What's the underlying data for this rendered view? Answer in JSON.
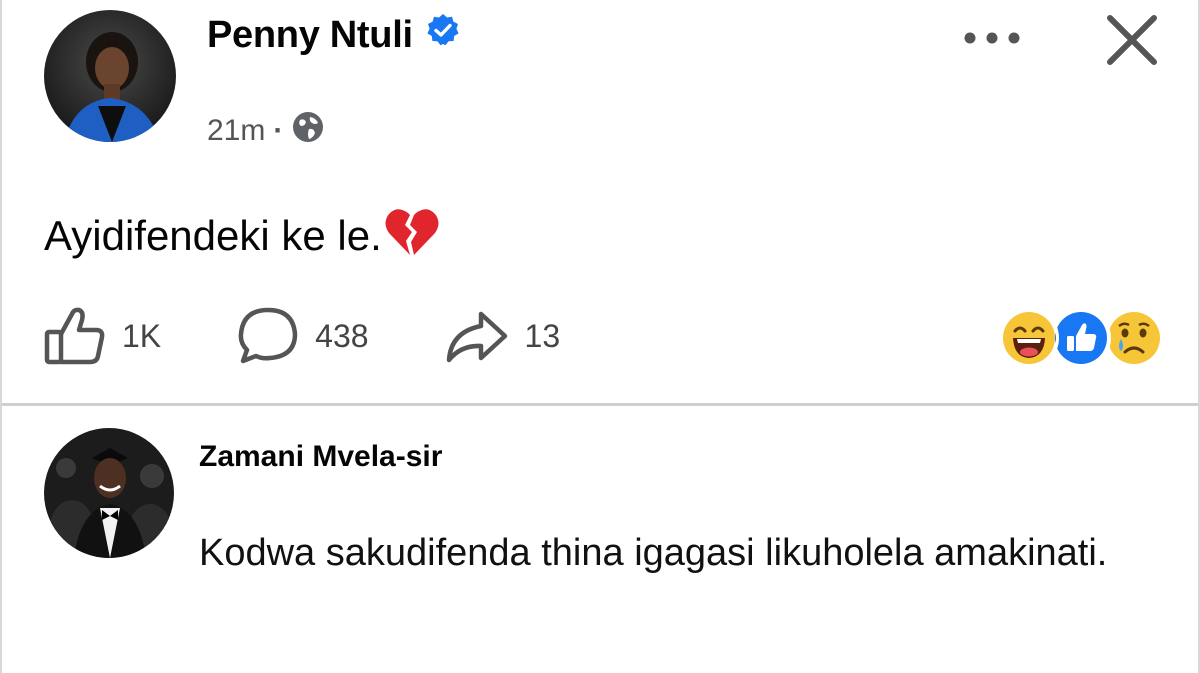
{
  "post": {
    "author": "Penny Ntuli",
    "time": "21m",
    "separator": "·",
    "text": "Ayidifendeki ke le.",
    "emoji": "broken-heart",
    "likes": "1K",
    "comments": "438",
    "shares": "13",
    "reactions": [
      "laughing-face",
      "like-thumb",
      "sad-tear-face"
    ]
  },
  "comment": {
    "author": "Zamani Mvela-sir",
    "text": "Kodwa sakudifenda thina igagasi likuholela amakinati."
  },
  "colors": {
    "verified": "#1877f2",
    "like_blue": "#1877f2",
    "emoji_yellow": "#f7c638"
  }
}
